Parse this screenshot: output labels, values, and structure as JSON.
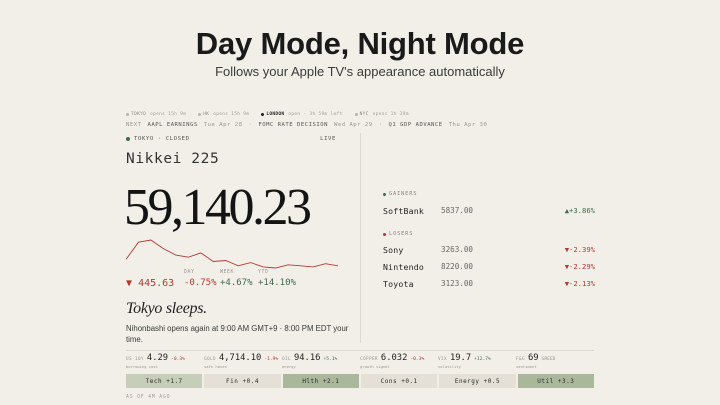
{
  "hero": {
    "title": "Day Mode, Night Mode",
    "subtitle": "Follows your Apple TV's appearance automatically"
  },
  "markets": [
    {
      "name": "TOKYO",
      "status": "opens 15h 9m",
      "active": false
    },
    {
      "name": "HK",
      "status": "opens 15h 9m",
      "active": false
    },
    {
      "name": "LONDON",
      "status": "open · 3h 59m left",
      "active": true
    },
    {
      "name": "NYC",
      "status": "opens 1h 39m",
      "active": false
    }
  ],
  "next": {
    "label": "NEXT",
    "events": [
      {
        "name": "AAPL EARNINGS",
        "date": "Tue Apr 28"
      },
      {
        "name": "FOMC RATE DECISION",
        "date": "Wed Apr 29"
      },
      {
        "name": "Q1 GDP ADVANCE",
        "date": "Thu Apr 30"
      }
    ],
    "separator": "·"
  },
  "status": {
    "left": "TOKYO · CLOSED",
    "right": "LIVE"
  },
  "index": {
    "name": "Nikkei 225",
    "price": "59,140.23",
    "change_arrow": "▼",
    "change_points": "445.63",
    "stats": [
      {
        "label": "DAY",
        "value": "-0.75%",
        "tone": "red"
      },
      {
        "label": "WEEK",
        "value": "+4.67%",
        "tone": "green"
      },
      {
        "label": "YTD",
        "value": "+14.10%",
        "tone": "green"
      }
    ],
    "sparkline": [
      58,
      74,
      76,
      68,
      62,
      60,
      64,
      56,
      57,
      52,
      55,
      51,
      50,
      53,
      52,
      51,
      54,
      52
    ]
  },
  "tagline": "Tokyo sleeps.",
  "opens_text": "Nihonbashi opens again at 9:00 AM GMT+9 · 8:00 PM EDT your time.",
  "gainers": {
    "title": "GAINERS",
    "items": [
      {
        "name": "SoftBank",
        "price": "5837.00",
        "change": "▲+3.86%"
      }
    ]
  },
  "losers": {
    "title": "LOSERS",
    "items": [
      {
        "name": "Sony",
        "price": "3263.00",
        "change": "▼-2.39%"
      },
      {
        "name": "Nintendo",
        "price": "8220.00",
        "change": "▼-2.29%"
      },
      {
        "name": "Toyota",
        "price": "3123.00",
        "change": "▼-2.13%"
      }
    ]
  },
  "tickers": [
    {
      "sym": "US 10Y",
      "value": "4.29",
      "change": "-0.3%",
      "tone": "red",
      "sub": "borrowing cost"
    },
    {
      "sym": "GOLD",
      "value": "4,714.10",
      "change": "-1.9%",
      "tone": "red",
      "sub": "safe haven"
    },
    {
      "sym": "OIL",
      "value": "94.16",
      "change": "+5.1%",
      "tone": "green",
      "sub": "energy"
    },
    {
      "sym": "COPPER",
      "value": "6.032",
      "change": "-0.3%",
      "tone": "red",
      "sub": "growth signal"
    },
    {
      "sym": "VIX",
      "value": "19.7",
      "change": "+12.7%",
      "tone": "green",
      "sub": "volatility"
    },
    {
      "sym": "F&G",
      "value": "69",
      "change": "GREED",
      "tone": "muted",
      "sub": "sentiment"
    }
  ],
  "sectors": [
    {
      "label": "Tech +1.7",
      "shade": "mid"
    },
    {
      "label": "Fin +0.4",
      "shade": "light"
    },
    {
      "label": "Hlth +2.1",
      "shade": "dark"
    },
    {
      "label": "Cons +0.1",
      "shade": "light"
    },
    {
      "label": "Energy +0.5",
      "shade": "light"
    },
    {
      "label": "Util +3.3",
      "shade": "dark"
    }
  ],
  "as_of": "AS OF 4M AGO",
  "colors": {
    "background": "#f2efe9",
    "positive": "#3e6b4a",
    "negative": "#b13a32",
    "sparkline": "#b13a32"
  }
}
